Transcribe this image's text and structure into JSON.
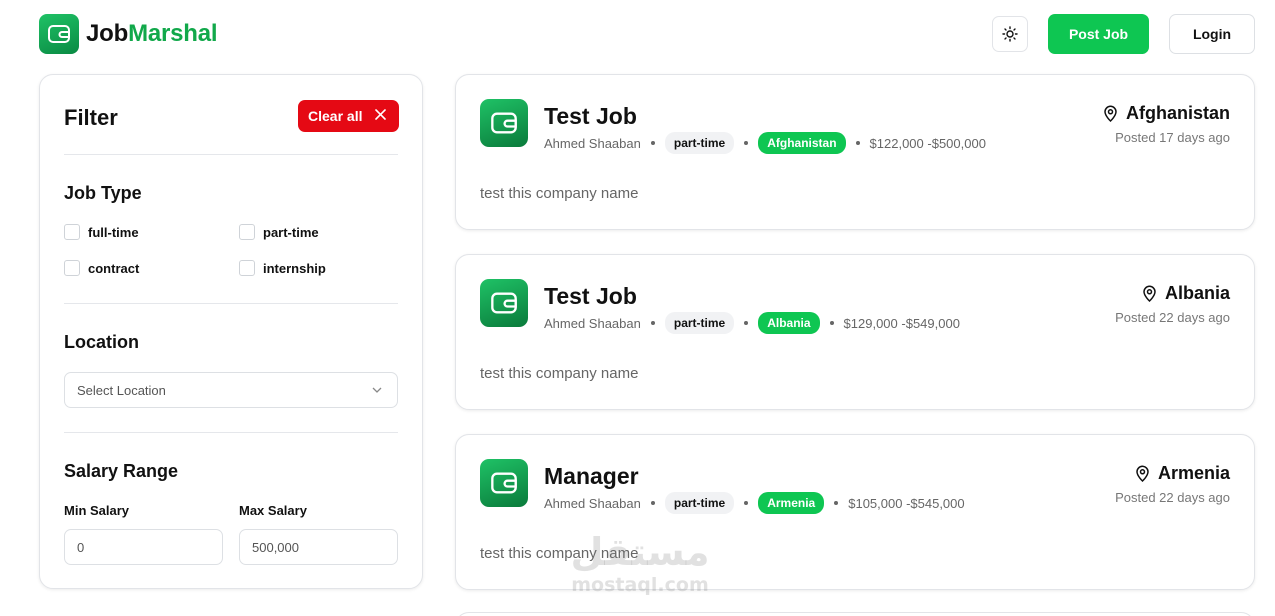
{
  "header": {
    "brand_part1": "Job",
    "brand_part2": "Marshal",
    "theme_icon": "sun-icon",
    "post_job_label": "Post Job",
    "login_label": "Login"
  },
  "filter": {
    "title": "Filter",
    "clear_all_label": "Clear all",
    "job_type": {
      "title": "Job Type",
      "options": [
        "full-time",
        "part-time",
        "contract",
        "internship"
      ]
    },
    "location": {
      "title": "Location",
      "placeholder": "Select Location"
    },
    "salary": {
      "title": "Salary Range",
      "min_label": "Min Salary",
      "min_value": "0",
      "max_label": "Max Salary",
      "max_value": "500,000"
    }
  },
  "jobs": [
    {
      "title": "Test Job",
      "company": "Ahmed Shaaban",
      "type": "part-time",
      "country_tag": "Afghanistan",
      "salary": "$122,000 -$500,000",
      "location": "Afghanistan",
      "posted": "Posted 17 days ago",
      "description": "test this company name"
    },
    {
      "title": "Test Job",
      "company": "Ahmed Shaaban",
      "type": "part-time",
      "country_tag": "Albania",
      "salary": "$129,000 -$549,000",
      "location": "Albania",
      "posted": "Posted 22 days ago",
      "description": "test this company name"
    },
    {
      "title": "Manager",
      "company": "Ahmed Shaaban",
      "type": "part-time",
      "country_tag": "Armenia",
      "salary": "$105,000 -$545,000",
      "location": "Armenia",
      "posted": "Posted 22 days ago",
      "description": "test this company name"
    }
  ],
  "watermark": {
    "arabic": "مستقل",
    "latin": "mostaql.com"
  },
  "colors": {
    "accent": "#0ec652",
    "brand_green": "#11a84a",
    "danger": "#e50914"
  }
}
